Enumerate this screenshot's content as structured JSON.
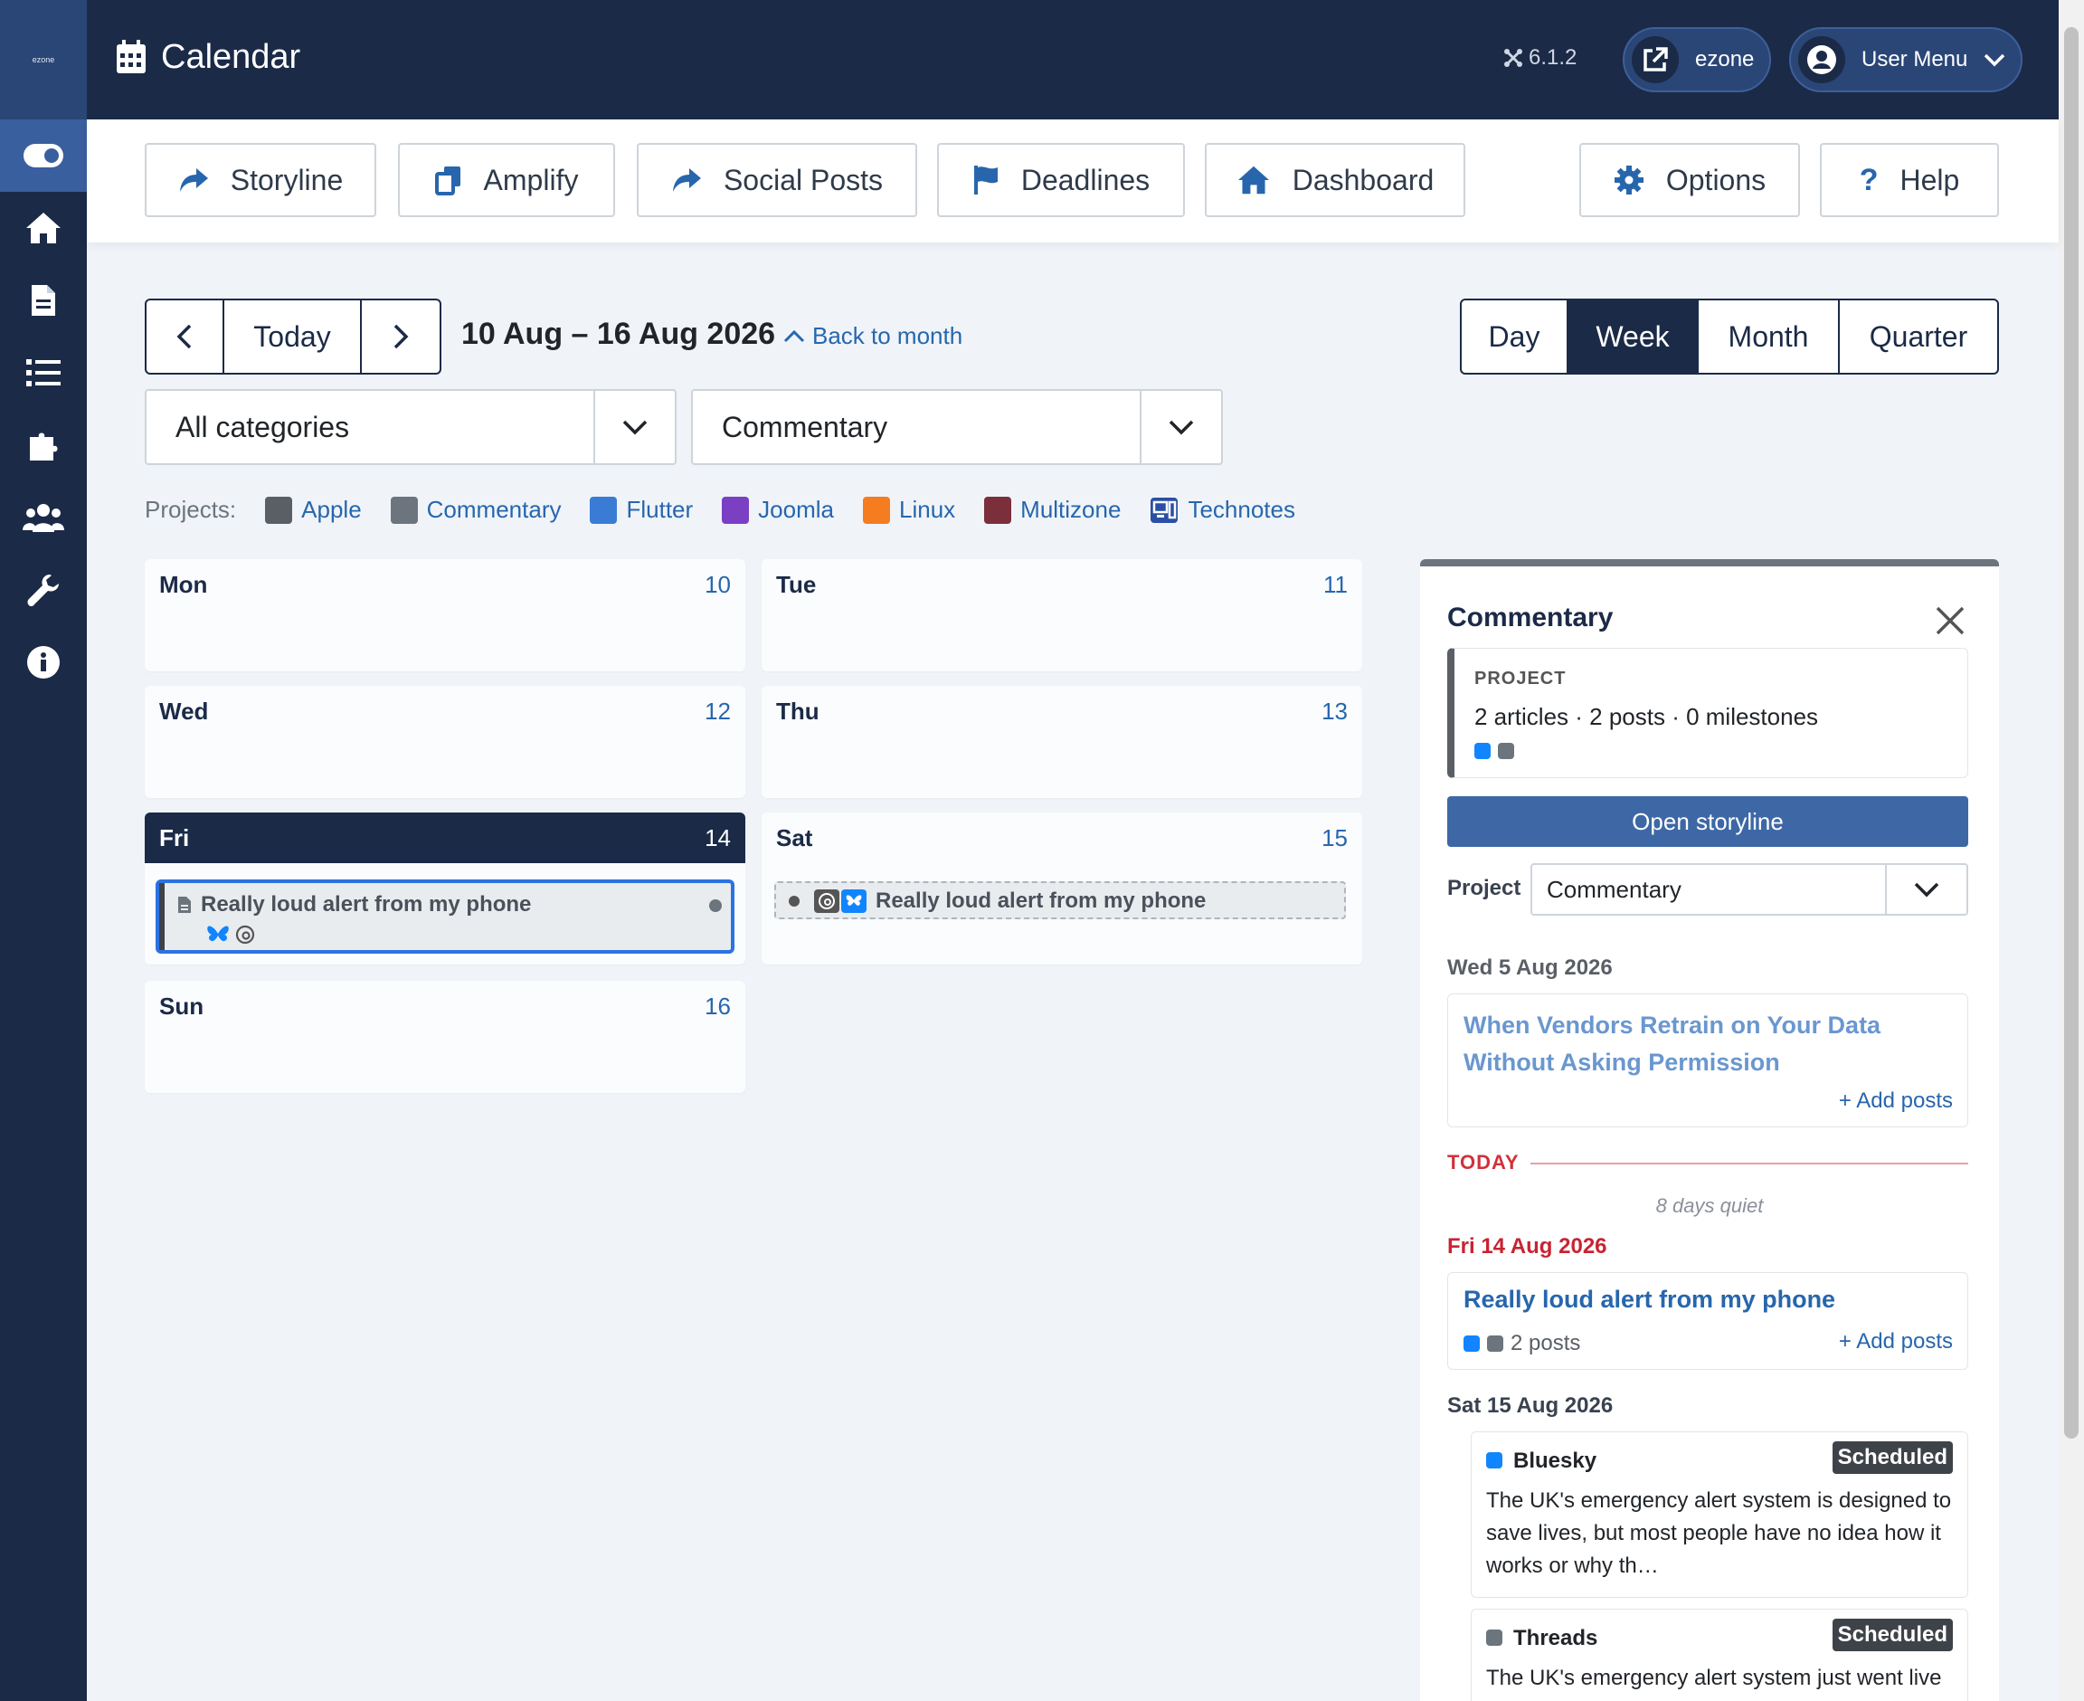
{
  "app": {
    "logo_text": "ezone",
    "title": "Calendar",
    "version": "6.1.2",
    "site_button": "ezone",
    "user_menu": "User Menu"
  },
  "sidebar": {
    "items": [
      "toggle-icon",
      "home-icon",
      "document-icon",
      "list-icon",
      "puzzle-icon",
      "users-icon",
      "wrench-icon",
      "info-icon"
    ]
  },
  "toolbar": {
    "storyline": "Storyline",
    "amplify": "Amplify",
    "social_posts": "Social Posts",
    "deadlines": "Deadlines",
    "dashboard": "Dashboard",
    "options": "Options",
    "help": "Help"
  },
  "nav": {
    "today": "Today",
    "range": "10 Aug – 16 Aug 2026",
    "back": "Back to month"
  },
  "views": {
    "day": "Day",
    "week": "Week",
    "month": "Month",
    "quarter": "Quarter",
    "active": "Week"
  },
  "filters": {
    "category": "All categories",
    "project": "Commentary"
  },
  "projects": {
    "label": "Projects:",
    "items": [
      {
        "name": "Apple",
        "color": "#5a5f66"
      },
      {
        "name": "Commentary",
        "color": "#6c757d"
      },
      {
        "name": "Flutter",
        "color": "#3a7bd5"
      },
      {
        "name": "Joomla",
        "color": "#7b3fc4"
      },
      {
        "name": "Linux",
        "color": "#f57c1f"
      },
      {
        "name": "Multizone",
        "color": "#7a2f3a"
      },
      {
        "name": "Technotes",
        "color": "#2b4fa5"
      }
    ]
  },
  "days": [
    {
      "name": "Mon",
      "num": "10"
    },
    {
      "name": "Tue",
      "num": "11"
    },
    {
      "name": "Wed",
      "num": "12"
    },
    {
      "name": "Thu",
      "num": "13"
    },
    {
      "name": "Fri",
      "num": "14"
    },
    {
      "name": "Sat",
      "num": "15"
    },
    {
      "name": "Sun",
      "num": "16"
    }
  ],
  "events": {
    "fri_title": "Really loud alert from my phone",
    "sat_title": "Really loud alert from my phone"
  },
  "panel": {
    "title": "Commentary",
    "project_label": "PROJECT",
    "stats": "2 articles · 2 posts · 0 milestones",
    "open_button": "Open storyline",
    "project_field_label": "Project",
    "project_value": "Commentary",
    "date1": "Wed 5 Aug 2026",
    "article1_title": "When Vendors Retrain on Your Data Without Asking Permission",
    "add_posts": "+ Add posts",
    "today_label": "TODAY",
    "quiet": "8 days quiet",
    "date2": "Fri 14 Aug 2026",
    "article2_title": "Really loud alert from my phone",
    "article2_posts": "2 posts",
    "date3": "Sat 15 Aug 2026",
    "post1": {
      "network": "Bluesky",
      "status": "Scheduled",
      "text": "The UK's emergency alert system is designed to save lives, but most people have no idea how it works or why th…",
      "color": "#1185fe"
    },
    "post2": {
      "network": "Threads",
      "status": "Scheduled",
      "text": "The UK's emergency alert system just went live and it's genuinely disruptive because it is",
      "color": "#6c757d"
    }
  }
}
